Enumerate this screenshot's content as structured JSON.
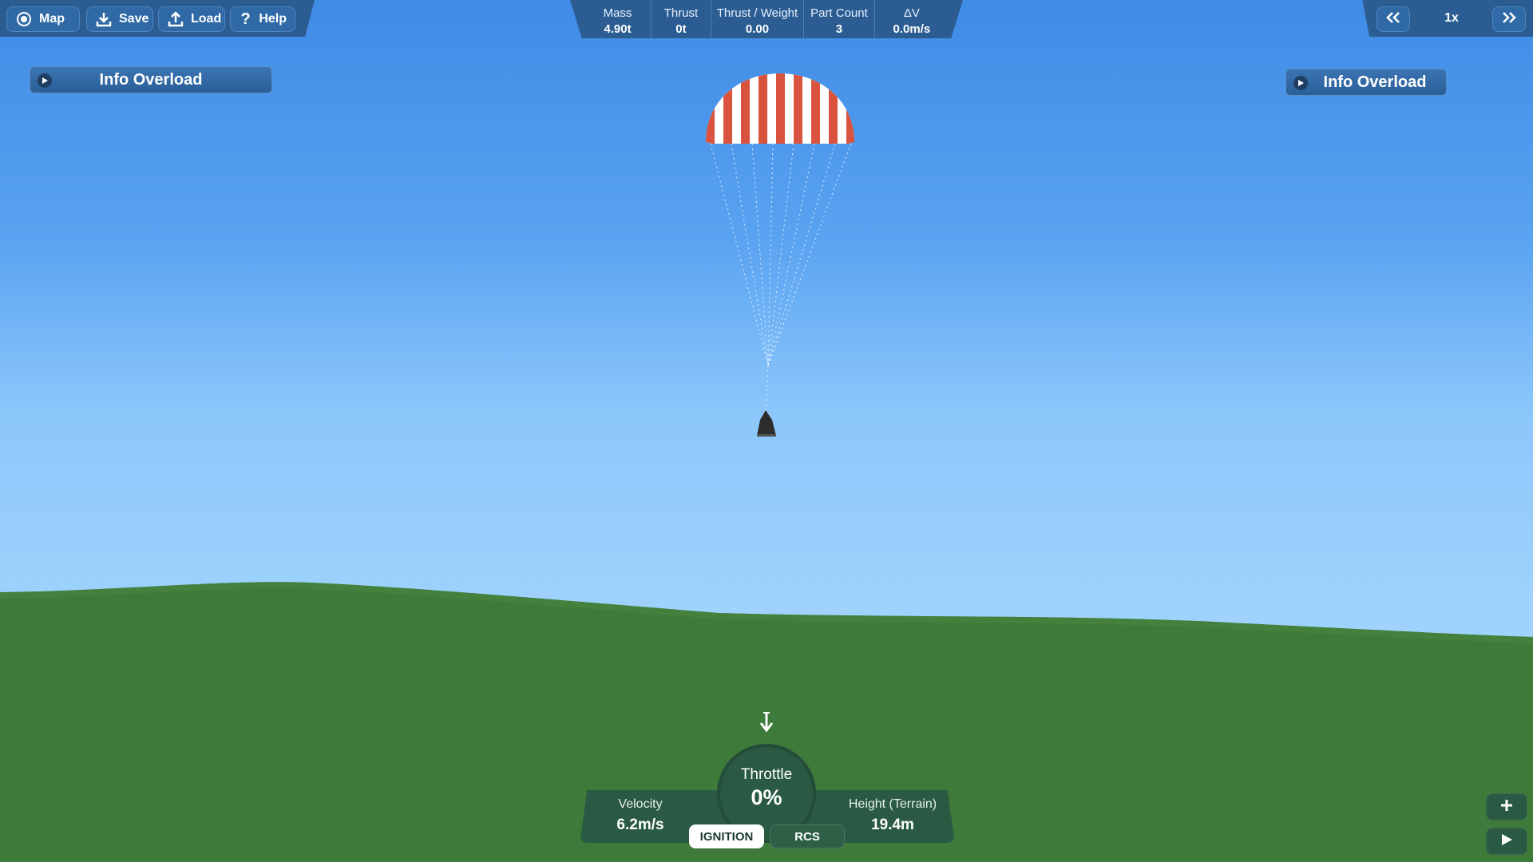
{
  "toolbar": {
    "map_label": "Map",
    "save_label": "Save",
    "load_label": "Load",
    "help_label": "Help"
  },
  "stats": {
    "mass": {
      "label": "Mass",
      "value": "4.90t"
    },
    "thrust": {
      "label": "Thrust",
      "value": "0t"
    },
    "twr": {
      "label": "Thrust / Weight",
      "value": "0.00"
    },
    "parts": {
      "label": "Part Count",
      "value": "3"
    },
    "dv": {
      "label": "ΔV",
      "value": "0.0m/s"
    }
  },
  "timewarp": {
    "speed": "1x",
    "slower_icon": "double-chevron-left-icon",
    "faster_icon": "double-chevron-right-icon"
  },
  "info_left": {
    "label": "Info Overload"
  },
  "info_right": {
    "label": "Info Overload"
  },
  "hud": {
    "velocity": {
      "label": "Velocity",
      "value": "6.2m/s"
    },
    "height": {
      "label": "Height (Terrain)",
      "value": "19.4m"
    },
    "throttle": {
      "label": "Throttle",
      "value": "0%",
      "level": 0
    },
    "ignition_label": "IGNITION",
    "rcs_label": "RCS",
    "direction_icon": "down-arrow-icon"
  },
  "bottom_right": {
    "zoom_icon": "plus-icon",
    "play_icon": "play-icon"
  },
  "colors": {
    "ui_blue": "#2b5d93",
    "hud_green": "#2a5a44",
    "ground_green": "#3e7a3a",
    "parachute_red": "#d9533f"
  }
}
